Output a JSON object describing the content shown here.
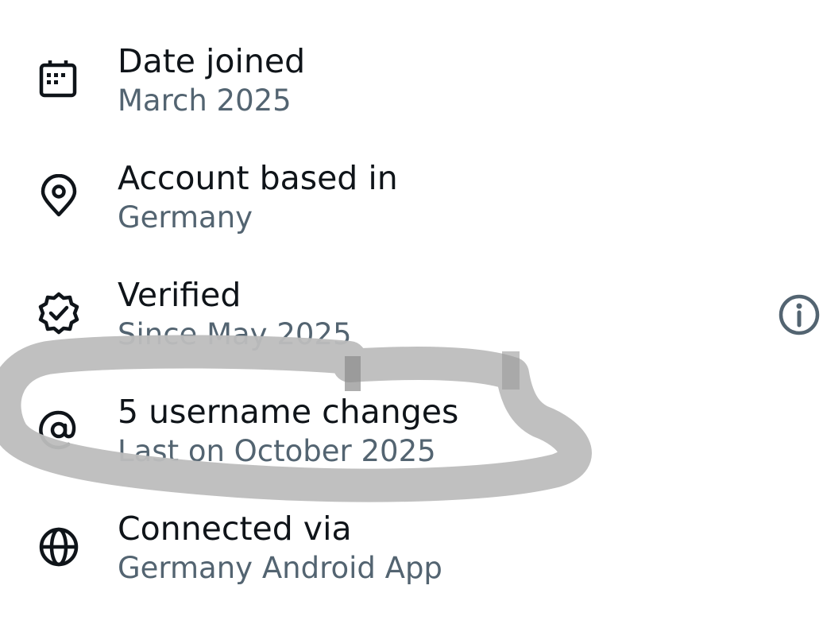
{
  "items": [
    {
      "icon": "calendar-icon",
      "title": "Date joined",
      "subtitle": "March 2025"
    },
    {
      "icon": "location-pin-icon",
      "title": "Account based in",
      "subtitle": "Germany"
    },
    {
      "icon": "verified-badge-icon",
      "title": "Verified",
      "subtitle": "Since May 2025"
    },
    {
      "icon": "at-sign-icon",
      "title": "5 username changes",
      "subtitle": "Last on October 2025"
    },
    {
      "icon": "globe-icon",
      "title": "Connected via",
      "subtitle": "Germany Android App"
    }
  ],
  "info_icon": "info-icon",
  "colors": {
    "title_text": "#0f1419",
    "subtitle_text": "#536471",
    "icon": "#0f1419",
    "info_icon": "#536471",
    "highlight_scribble": "#bdbdbd"
  }
}
